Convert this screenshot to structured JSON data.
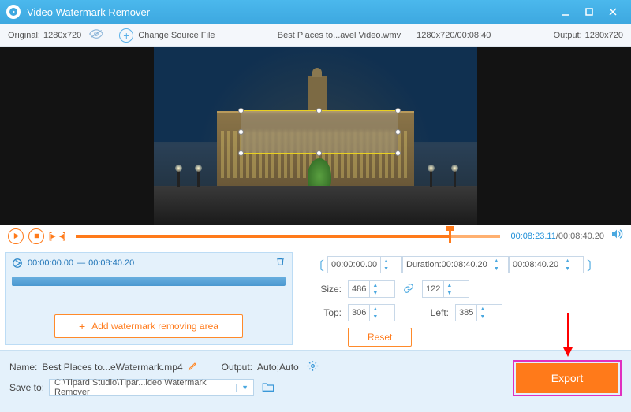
{
  "titlebar": {
    "app_name": "Video Watermark Remover"
  },
  "infobar": {
    "original_label": "Original:",
    "original_size": "1280x720",
    "change_source": "Change Source File",
    "filename": "Best Places to...avel Video.wmv",
    "file_meta": "1280x720/00:08:40",
    "output_label": "Output:",
    "output_size": "1280x720"
  },
  "controls": {
    "current_time": "00:08:23.11",
    "total_time": "00:08:40.20"
  },
  "clip": {
    "start": "00:00:00.00",
    "sep": "—",
    "end": "00:08:40.20"
  },
  "add_area_label": "Add watermark removing area",
  "trim": {
    "start": "00:00:00.00",
    "duration_label": "Duration:",
    "duration": "00:08:40.20",
    "end": "00:08:40.20"
  },
  "size": {
    "label": "Size:",
    "w": "486",
    "h": "122"
  },
  "pos": {
    "top_label": "Top:",
    "top": "306",
    "left_label": "Left:",
    "left": "385"
  },
  "reset_label": "Reset",
  "bottom": {
    "name_label": "Name:",
    "name_value": "Best Places to...eWatermark.mp4",
    "output_label": "Output:",
    "output_value": "Auto;Auto",
    "saveto_label": "Save to:",
    "saveto_value": "C:\\Tipard Studio\\Tipar...ideo Watermark Remover"
  },
  "export_label": "Export"
}
